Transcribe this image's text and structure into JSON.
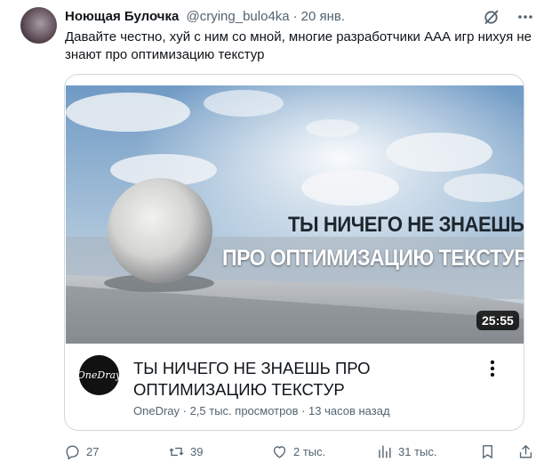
{
  "post": {
    "author_name": "Ноющая Булочка",
    "handle": "@crying_bulo4ka",
    "separator": "·",
    "date": "20 янв.",
    "text": "Давайте честно, хуй с ним со мной, многие разработчики ААА игр нихуя не знают про оптимизацию текстур"
  },
  "video_card": {
    "overlay_line1": "ТЫ НИЧЕГО НЕ ЗНАЕШЬ",
    "overlay_line2": "ПРО ОПТИМИЗАЦИЮ ТЕКСТУР",
    "duration": "25:55",
    "channel_logo_text": "OneDray",
    "title": "ТЫ НИЧЕГО НЕ ЗНАЕШЬ ПРО ОПТИМИЗАЦИЮ ТЕКСТУР",
    "meta": "OneDray · 2,5 тыс. просмотров · 13 часов назад"
  },
  "actions": {
    "replies": "27",
    "retweets": "39",
    "likes": "2 тыс.",
    "views": "31 тыс."
  },
  "colors": {
    "text": "#0f1419",
    "secondary": "#536471",
    "border": "#cfd9de"
  },
  "icons": [
    "grok-icon",
    "more-icon",
    "kebab-icon",
    "reply-icon",
    "retweet-icon",
    "like-icon",
    "views-icon",
    "bookmark-icon",
    "share-icon"
  ]
}
